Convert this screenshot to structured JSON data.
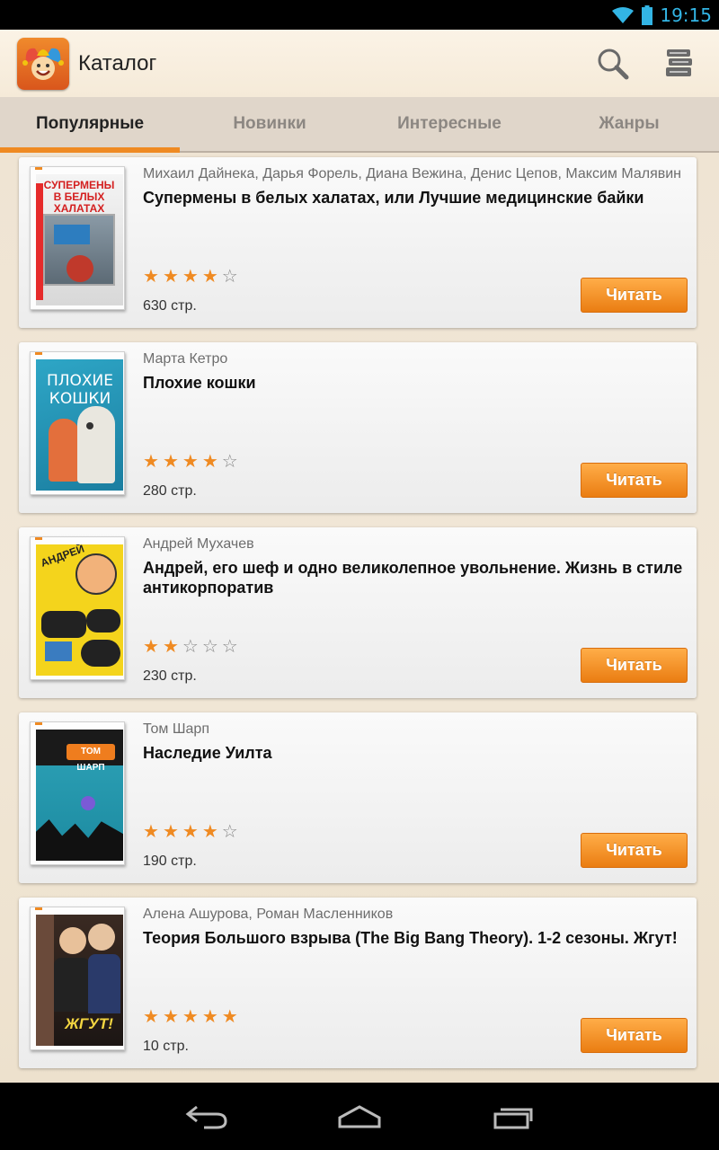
{
  "status_bar": {
    "time": "19:15"
  },
  "app": {
    "title": "Каталог"
  },
  "tabs": [
    {
      "label": "Популярные",
      "active": true
    },
    {
      "label": "Новинки",
      "active": false
    },
    {
      "label": "Интересные",
      "active": false
    },
    {
      "label": "Жанры",
      "active": false
    }
  ],
  "books": [
    {
      "author": "Михаил Дайнека, Дарья Форель, Диана Вежина, Денис Цепов, Максим Малявин",
      "title": "Супермены в белых халатах, или Лучшие медицинские байки",
      "rating": 4,
      "pages": "630 стр.",
      "read_label": "Читать",
      "cover_text": "СУПЕРМЕНЫ В БЕЛЫХ ХАЛАТАХ"
    },
    {
      "author": "Марта Кетро",
      "title": "Плохие кошки",
      "rating": 4,
      "pages": "280 стр.",
      "read_label": "Читать",
      "cover_text": "ПЛОХИЕ КОШКИ"
    },
    {
      "author": "Андрей Мухачев",
      "title": "Андрей, его шеф и одно великолепное увольнение. Жизнь в стиле антикорпоратив",
      "rating": 2,
      "pages": "230 стр.",
      "read_label": "Читать",
      "cover_text": "АНДРЕЙ"
    },
    {
      "author": "Том Шарп",
      "title": "Наследие Уилта",
      "rating": 4,
      "pages": "190 стр.",
      "read_label": "Читать",
      "cover_text": "ТОМ ШАРП"
    },
    {
      "author": "Алена Ашурова, Роман Масленников",
      "title": "Теория Большого взрыва (The Big Bang Theory). 1-2 сезоны. Жгут!",
      "rating": 5,
      "pages": "10 стр.",
      "read_label": "Читать",
      "cover_text": "ЖГУТ!"
    }
  ],
  "colors": {
    "accent": "#ef8a22",
    "statusbar_text": "#33b5e5"
  },
  "icons": {
    "search": "search-icon",
    "library": "library-books-icon",
    "back": "back-icon",
    "home": "home-icon",
    "recents": "recent-apps-icon"
  }
}
